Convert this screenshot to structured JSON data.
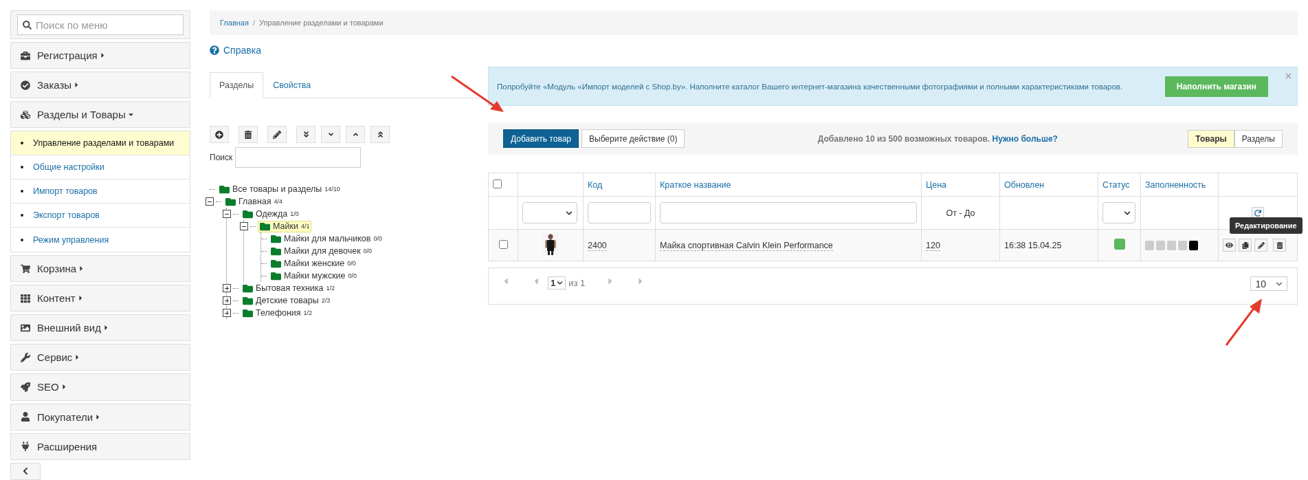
{
  "sidebar": {
    "search": {
      "placeholder": "Поиск по меню"
    },
    "items": [
      {
        "label": "Регистрация",
        "kind": "menu",
        "expanded": false
      },
      {
        "label": "Заказы",
        "kind": "menu",
        "expanded": false
      },
      {
        "label": "Разделы и Товары",
        "kind": "menu",
        "expanded": true,
        "children": [
          {
            "label": "Управление разделами и товарами",
            "selected": true
          },
          {
            "label": "Общие настройки",
            "selected": false
          },
          {
            "label": "Импорт товаров",
            "selected": false
          },
          {
            "label": "Экспорт товаров",
            "selected": false
          },
          {
            "label": "Режим управления",
            "selected": false
          }
        ]
      },
      {
        "label": "Корзина",
        "kind": "menu",
        "expanded": false
      },
      {
        "label": "Контент",
        "kind": "menu",
        "expanded": false
      },
      {
        "label": "Внешний вид",
        "kind": "menu",
        "expanded": false
      },
      {
        "label": "Сервис",
        "kind": "menu",
        "expanded": false
      },
      {
        "label": "SEO",
        "kind": "menu",
        "expanded": false
      },
      {
        "label": "Покупатели",
        "kind": "menu",
        "expanded": false
      },
      {
        "label": "Расширения",
        "kind": "link",
        "expanded": false
      }
    ]
  },
  "breadcrumb": [
    {
      "label": "Главная",
      "kind": "link"
    },
    {
      "label": "/",
      "kind": "separator"
    },
    {
      "label": "Управление разделами и товарами",
      "kind": "current"
    }
  ],
  "help_link": "Справка",
  "tabs": [
    {
      "label": "Разделы",
      "selected": true
    },
    {
      "label": "Свойства",
      "selected": false
    }
  ],
  "tree_search": {
    "label": "Поиск"
  },
  "tree": [
    {
      "label": "Все товары и разделы",
      "count": "14/10",
      "selected": false
    },
    {
      "label": "Главная",
      "count": "4/4",
      "selected": false,
      "expanded": true,
      "children": [
        {
          "label": "Одежда",
          "count": "1/0",
          "selected": false,
          "expanded": true,
          "children": [
            {
              "label": "Майки",
              "count": "4/1",
              "selected": true,
              "expanded": true,
              "children": [
                {
                  "label": "Майки для мальчиков",
                  "count": "0/0",
                  "selected": false
                },
                {
                  "label": "Майки для девочек",
                  "count": "0/0",
                  "selected": false
                },
                {
                  "label": "Майки женские",
                  "count": "0/0",
                  "selected": false
                },
                {
                  "label": "Майки мужские",
                  "count": "0/0",
                  "selected": false
                }
              ]
            }
          ]
        },
        {
          "label": "Бытовая техника",
          "count": "1/2",
          "selected": false,
          "expanded": false
        },
        {
          "label": "Детские товары",
          "count": "2/3",
          "selected": false,
          "expanded": false
        },
        {
          "label": "Телефония",
          "count": "1/2",
          "selected": false,
          "expanded": false
        }
      ]
    }
  ],
  "banner": {
    "text": "Попробуйте «Модуль «Импорт моделей с Shop.by». Наполните каталог Вашего интернет-магазина качественными фотографиями и полными характеристиками товаров.",
    "button": "Наполнить магазин",
    "close": "×"
  },
  "toolbar": {
    "add_button": "Добавить товар",
    "action_button": "Выберите действие (0)",
    "info": "Добавлено 10 из 500 возможных товаров.",
    "info_link": "Нужно больше?",
    "views": [
      {
        "label": "Товары",
        "selected": true
      },
      {
        "label": "Разделы",
        "selected": false
      }
    ]
  },
  "table": {
    "select_all_checked": false,
    "columns": [
      "",
      "",
      "Код",
      "Краткое название",
      "Цена",
      "Обновлен",
      "Статус",
      "Заполненность",
      ""
    ],
    "filter": {
      "price": "От - До"
    },
    "rows": [
      {
        "checked": false,
        "code": "2400",
        "name": "Майка спортивная Calvin Klein Performance",
        "price": "120",
        "updated": "16:38 15.04.25",
        "active": true,
        "fill_blocks": [
          {
            "color": "#cccccc"
          },
          {
            "color": "#cccccc"
          },
          {
            "color": "#cccccc"
          },
          {
            "color": "#cccccc"
          },
          {
            "color": "#000000"
          }
        ]
      }
    ],
    "tooltip": "Редактирование"
  },
  "pagination": {
    "page": "1",
    "of": "из 1",
    "page_size": "10"
  }
}
